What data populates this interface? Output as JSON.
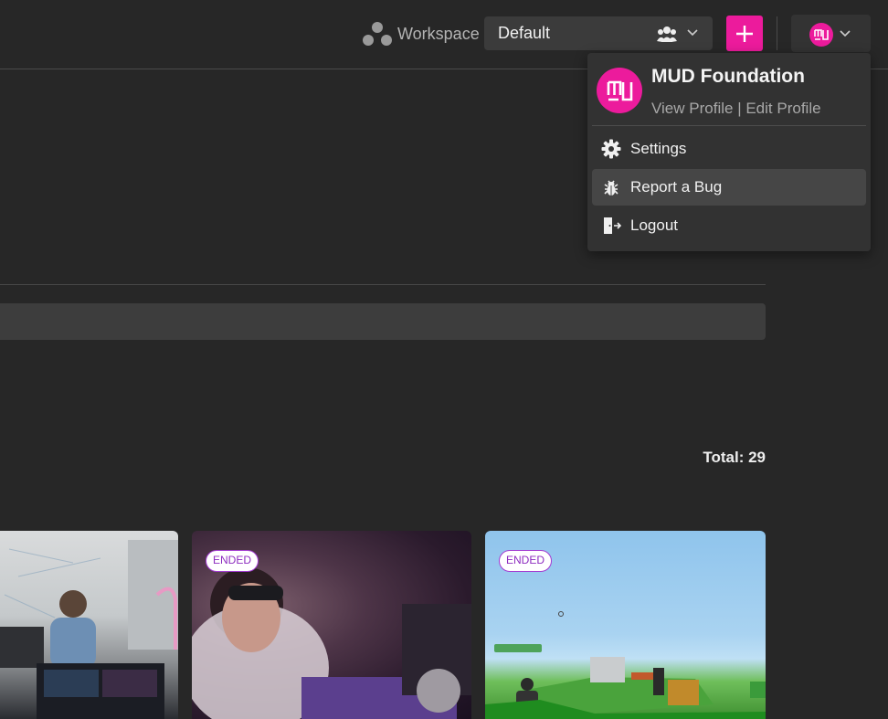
{
  "header": {
    "workspace_label": "Workspace",
    "workspace_value": "Default",
    "add_label": "+"
  },
  "main": {
    "total_label": "Total: 29"
  },
  "cards": [
    {
      "badge": ""
    },
    {
      "badge": "ENDED"
    },
    {
      "badge": "ENDED"
    }
  ],
  "profile_menu": {
    "name": "MUD Foundation",
    "view_profile": "View Profile",
    "separator": "|",
    "edit_profile": "Edit Profile",
    "items": [
      {
        "label": "Settings",
        "icon": "gear-icon"
      },
      {
        "label": "Report a Bug",
        "icon": "bug-icon"
      },
      {
        "label": "Logout",
        "icon": "logout-icon"
      }
    ]
  },
  "colors": {
    "accent": "#ec1b9c",
    "badge_border": "#a33bd1",
    "background": "#272727"
  }
}
